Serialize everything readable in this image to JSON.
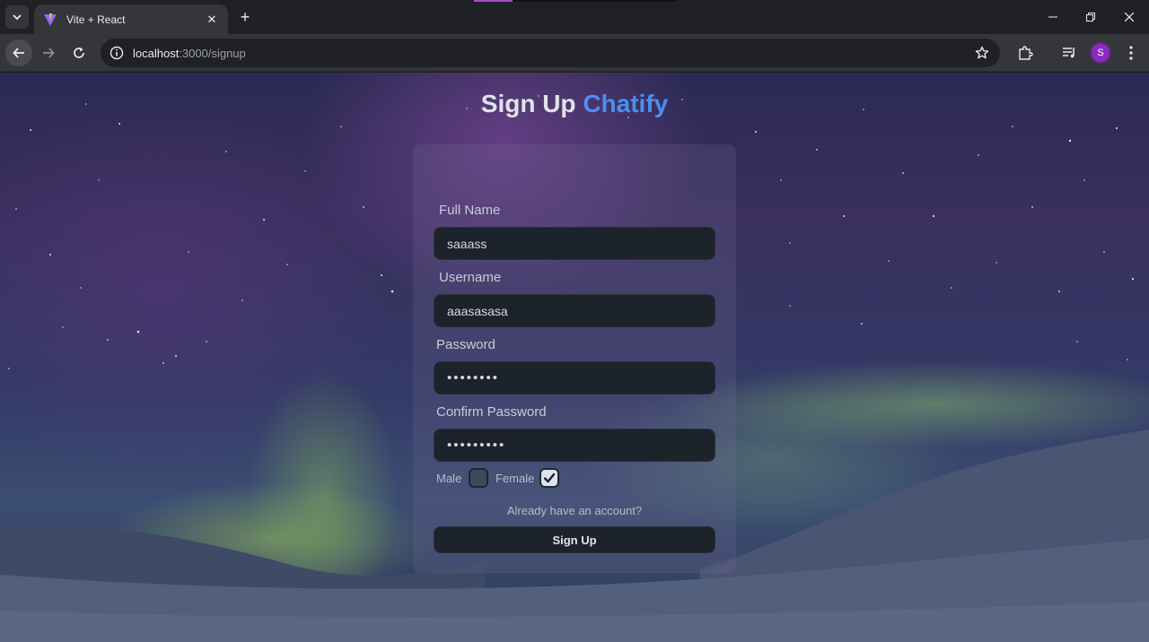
{
  "browser": {
    "tab_title": "Vite + React",
    "tab_close": "✕",
    "new_tab": "+",
    "url_host": "localhost",
    "url_path": ":3000/signup",
    "profile_initial": "S",
    "media_progress": 0.19
  },
  "form": {
    "title": "Sign Up",
    "brand": "Chatify",
    "full_name_label": "Full Name",
    "full_name_value": "saaass",
    "username_label": "Username",
    "username_value": "aaasasasa",
    "password_label": "Password",
    "password_value": "••••••••",
    "confirm_label": "Confirm Password",
    "confirm_value": "•••••••••",
    "male_label": "Male",
    "male_checked": false,
    "female_label": "Female",
    "female_checked": true,
    "login_link": "Already have an account?",
    "submit_label": "Sign Up"
  },
  "colors": {
    "accent": "#4a8ff0",
    "input_bg": "#1d232a",
    "avatar": "#8a2bbf"
  }
}
